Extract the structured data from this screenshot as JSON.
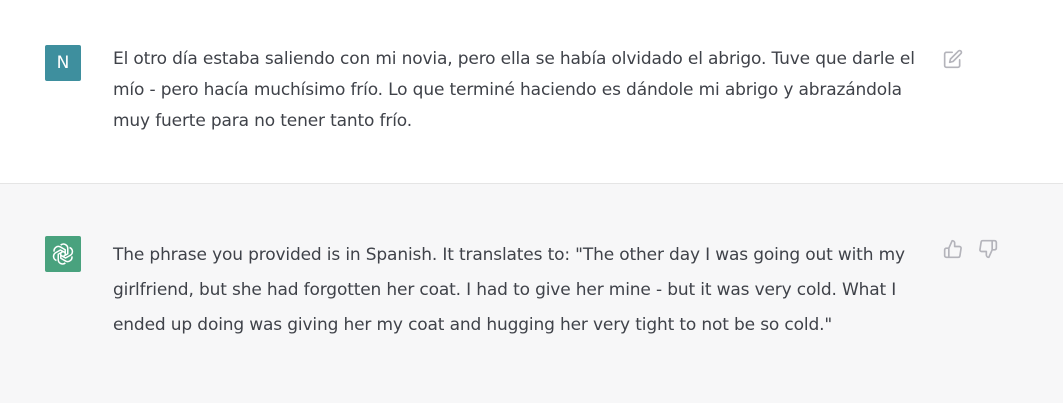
{
  "colors": {
    "user_avatar_bg": "#3e8f9e",
    "bot_avatar_bg": "#49a27e",
    "assistant_row_bg": "#f7f7f8",
    "text": "#3f4249",
    "icon": "#b4b4bb"
  },
  "conversation": {
    "user_message": {
      "avatar_initial": "N",
      "text": "El otro día estaba saliendo con mi novia, pero ella se había olvidado el abrigo. Tuve que darle el mío - pero hacía muchísimo frío. Lo que terminé haciendo es dándole mi abrigo y abrazándola muy fuerte para no tener tanto frío.",
      "actions": {
        "edit_icon": "edit-icon"
      }
    },
    "assistant_message": {
      "avatar_icon": "openai-logo-icon",
      "text": "The phrase you provided is in Spanish. It translates to: \"The other day I was going out with my girlfriend, but she had forgotten her coat. I had to give her mine - but it was very cold. What I ended up doing was giving her my coat and hugging her very tight to not be so cold.\"",
      "actions": {
        "thumbs_up_icon": "thumbs-up-icon",
        "thumbs_down_icon": "thumbs-down-icon"
      }
    }
  }
}
